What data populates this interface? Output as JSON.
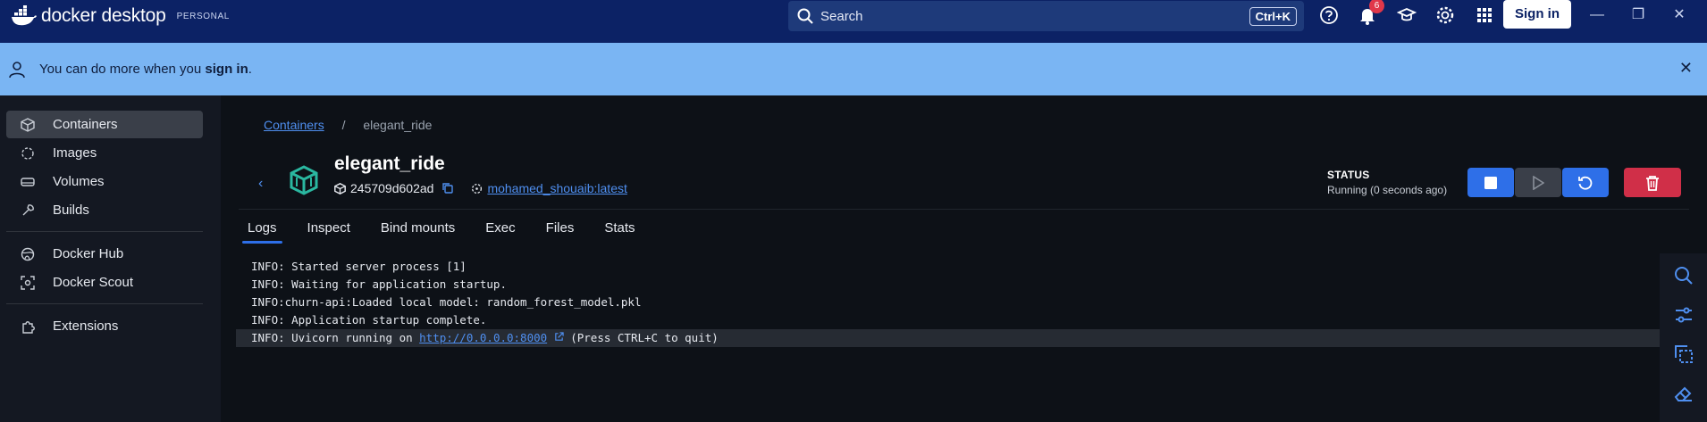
{
  "titlebar": {
    "brand": "docker desktop",
    "edition": "PERSONAL",
    "search_placeholder": "Search",
    "shortcut": "Ctrl+K",
    "notification_count": "6",
    "signin_label": "Sign in",
    "icons": [
      "help-icon",
      "bell-icon",
      "learn-icon",
      "gear-icon",
      "grid-icon"
    ]
  },
  "banner": {
    "text_prefix": "You can do more when you",
    "text_link": "sign in",
    "text_suffix": "."
  },
  "sidebar": {
    "items": [
      {
        "label": "Containers",
        "icon": "containers-icon",
        "active": true
      },
      {
        "label": "Images",
        "icon": "images-icon"
      },
      {
        "label": "Volumes",
        "icon": "volumes-icon"
      },
      {
        "label": "Builds",
        "icon": "builds-icon"
      },
      {
        "label": "Docker Hub",
        "icon": "docker-hub-icon"
      },
      {
        "label": "Docker Scout",
        "icon": "docker-scout-icon"
      },
      {
        "label": "Extensions",
        "icon": "extensions-icon"
      }
    ]
  },
  "breadcrumb": {
    "parent": "Containers",
    "sep": "/",
    "current": "elegant_ride"
  },
  "container": {
    "name": "elegant_ride",
    "id": "245709d602ad",
    "image": "mohamed_shouaib:latest",
    "status_label": "STATUS",
    "status_value": "Running (0 seconds ago)"
  },
  "tabs": [
    "Logs",
    "Inspect",
    "Bind mounts",
    "Exec",
    "Files",
    "Stats"
  ],
  "logs": {
    "lines": [
      "INFO: Started server process [1]",
      "INFO: Waiting for application startup.",
      "INFO:churn-api:Loaded local model: random_forest_model.pkl",
      "INFO: Application startup complete."
    ],
    "last_prefix": "INFO: Uvicorn running on ",
    "last_url": "http://0.0.0.0:8000",
    "last_suffix": " (Press CTRL+C to quit)"
  },
  "colors": {
    "titlebar": "#0c2265",
    "banner": "#7ab5f3",
    "accent": "#2e6fe8",
    "danger": "#d02f48"
  }
}
